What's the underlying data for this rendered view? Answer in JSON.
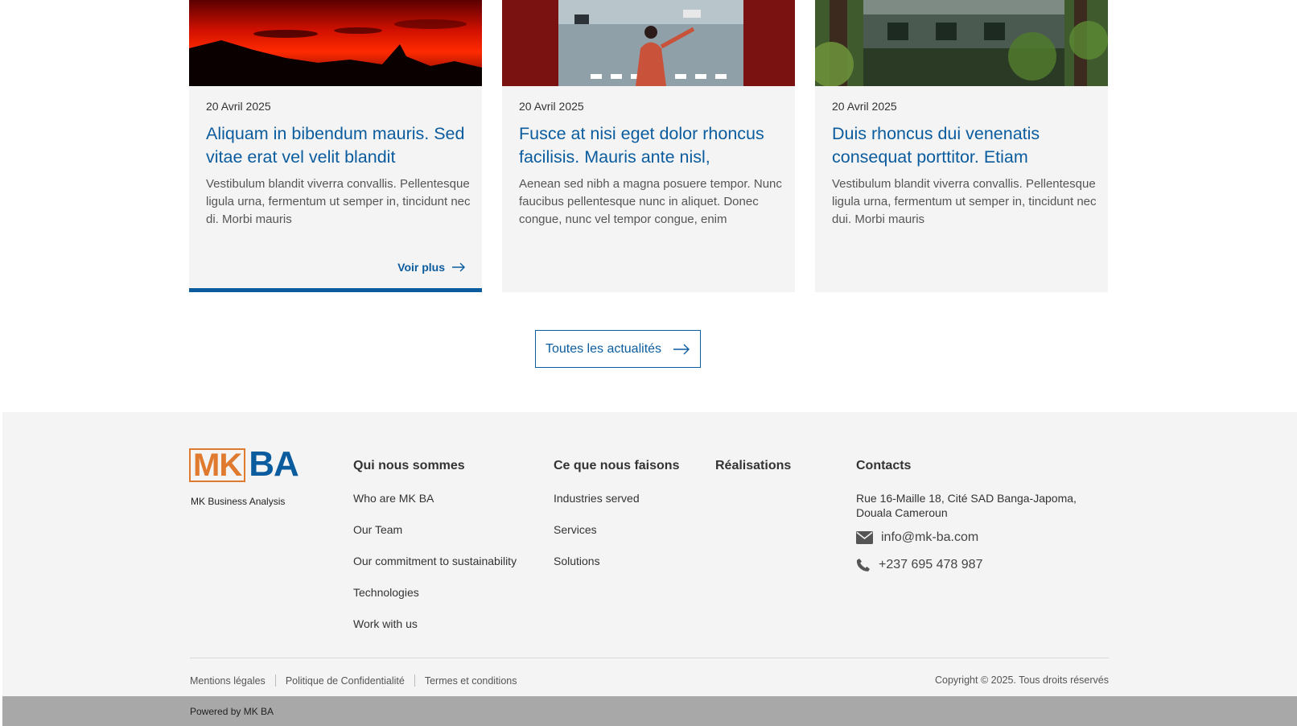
{
  "cards": [
    {
      "date": "20 Avril 2025",
      "title": "Aliquam in bibendum mauris. Sed vitae erat vel velit blandit",
      "excerpt": "Vestibulum blandit viverra convallis. Pellentesque ligula urna, fermentum ut semper in, tincidunt nec di. Morbi mauris",
      "more_label": "Voir plus"
    },
    {
      "date": "20 Avril 2025",
      "title": "Fusce at nisi eget dolor rhoncus facilisis. Mauris ante nisl,",
      "excerpt": "Aenean sed nibh a magna posuere tempor. Nunc faucibus pellentesque nunc in aliquet. Donec congue, nunc vel tempor congue, enim"
    },
    {
      "date": "20 Avril 2025",
      "title": "Duis rhoncus dui venenatis consequat porttitor. Etiam",
      "excerpt": "Vestibulum blandit viverra convallis. Pellentesque ligula urna, fermentum ut semper in, tincidunt nec dui. Morbi mauris"
    }
  ],
  "all_news_label": "Toutes les actualités",
  "footer": {
    "logo": {
      "mk": "MK",
      "ba": "BA",
      "tagline": "MK Business Analysis"
    },
    "columns": [
      {
        "heading": "Qui nous sommes",
        "links": [
          "Who are MK BA",
          "Our Team",
          "Our commitment to sustainability",
          "Technologies",
          "Work with us"
        ]
      },
      {
        "heading": "Ce que nous faisons",
        "links": [
          "Industries served",
          "Services",
          "Solutions"
        ]
      },
      {
        "heading": "Réalisations",
        "links": []
      }
    ],
    "contacts": {
      "heading": "Contacts",
      "address": "Rue 16-Maille 18, Cité SAD Banga-Japoma, Douala Cameroun",
      "email": "info@mk-ba.com",
      "phone": "+237 695 478 987"
    },
    "legal": [
      "Mentions légales",
      "Politique de Confidentialité",
      "Termes et conditions"
    ],
    "copyright": "Copyright © 2025. Tous droits réservés",
    "powered_by": "Powered by MK BA"
  },
  "colors": {
    "primary": "#0b5c9e",
    "logo_orange": "#e07a2e",
    "footer_bg": "#f4f4f4",
    "powered_bg": "#a8a8a8"
  }
}
